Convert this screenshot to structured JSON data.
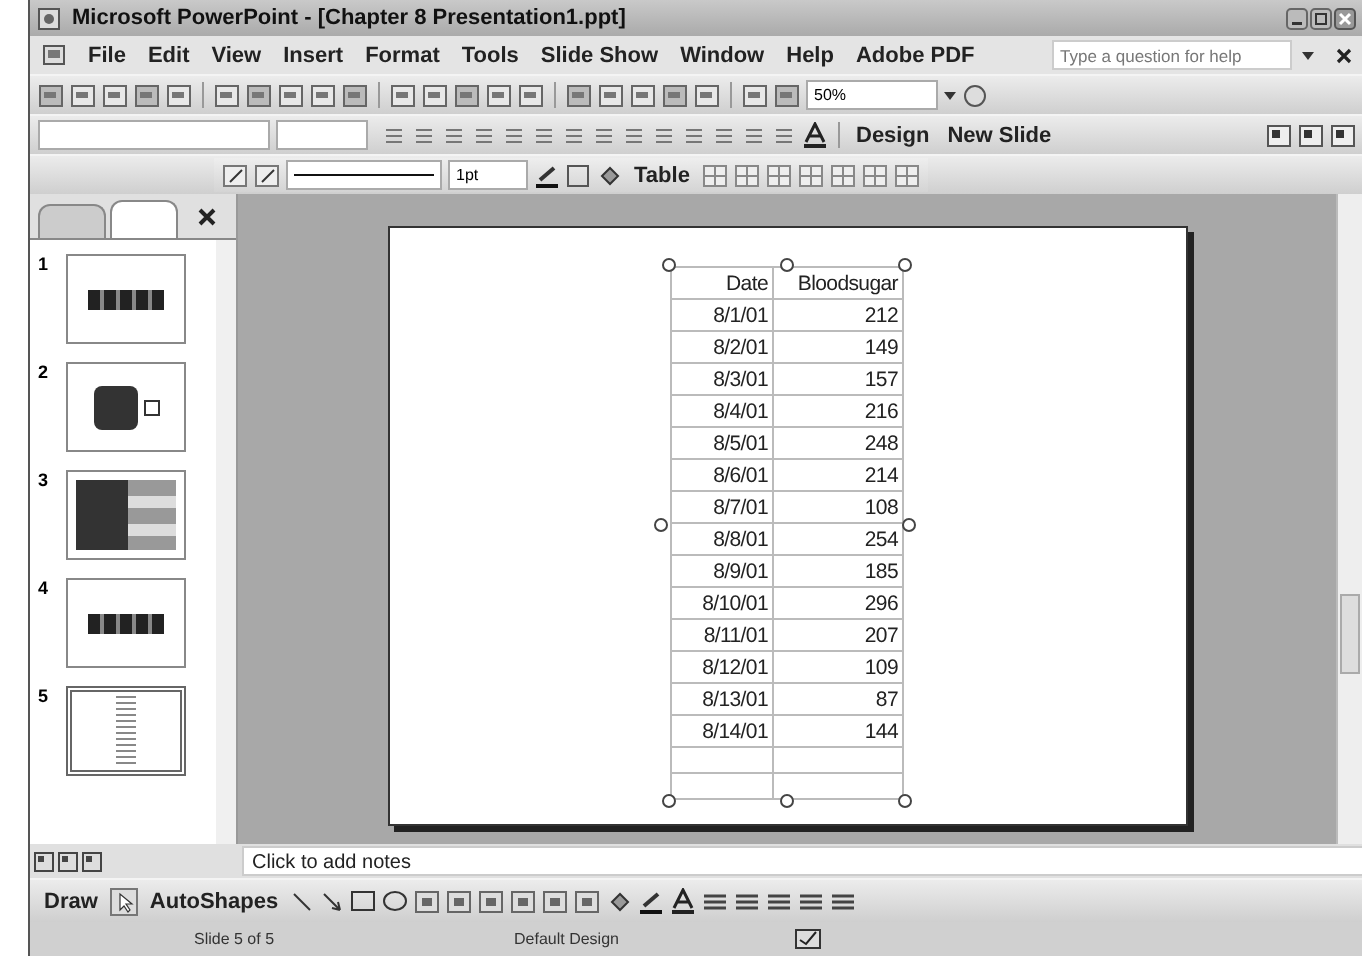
{
  "window": {
    "title": "Microsoft PowerPoint - [Chapter 8 Presentation1.ppt]"
  },
  "menu": [
    {
      "label": "File"
    },
    {
      "label": "Edit"
    },
    {
      "label": "View"
    },
    {
      "label": "Insert"
    },
    {
      "label": "Format"
    },
    {
      "label": "Tools"
    },
    {
      "label": "Slide Show"
    },
    {
      "label": "Window"
    },
    {
      "label": "Help"
    },
    {
      "label": "Adobe PDF"
    }
  ],
  "help_search": {
    "placeholder": "Type a question for help"
  },
  "standard_toolbar": {
    "zoom": "50%"
  },
  "formatting_toolbar": {
    "design": "Design",
    "new_slide": "New Slide"
  },
  "tables_toolbar": {
    "line_weight": "1pt",
    "table": "Table"
  },
  "slides_pane": {
    "slides": [
      {
        "number": "1",
        "selected": false
      },
      {
        "number": "2",
        "selected": false
      },
      {
        "number": "3",
        "selected": false
      },
      {
        "number": "4",
        "selected": false
      },
      {
        "number": "5",
        "selected": true
      }
    ]
  },
  "table": {
    "columns": [
      "Date",
      "Bloodsugar"
    ],
    "rows": [
      [
        "8/1/01",
        "212"
      ],
      [
        "8/2/01",
        "149"
      ],
      [
        "8/3/01",
        "157"
      ],
      [
        "8/4/01",
        "216"
      ],
      [
        "8/5/01",
        "248"
      ],
      [
        "8/6/01",
        "214"
      ],
      [
        "8/7/01",
        "108"
      ],
      [
        "8/8/01",
        "254"
      ],
      [
        "8/9/01",
        "185"
      ],
      [
        "8/10/01",
        "296"
      ],
      [
        "8/11/01",
        "207"
      ],
      [
        "8/12/01",
        "109"
      ],
      [
        "8/13/01",
        "87"
      ],
      [
        "8/14/01",
        "144"
      ]
    ]
  },
  "notes": {
    "placeholder": "Click to add notes"
  },
  "drawing_toolbar": {
    "draw": "Draw",
    "autoshapes": "AutoShapes"
  },
  "status_bar": {
    "slide": "Slide 5 of 5",
    "design": "Default Design"
  }
}
